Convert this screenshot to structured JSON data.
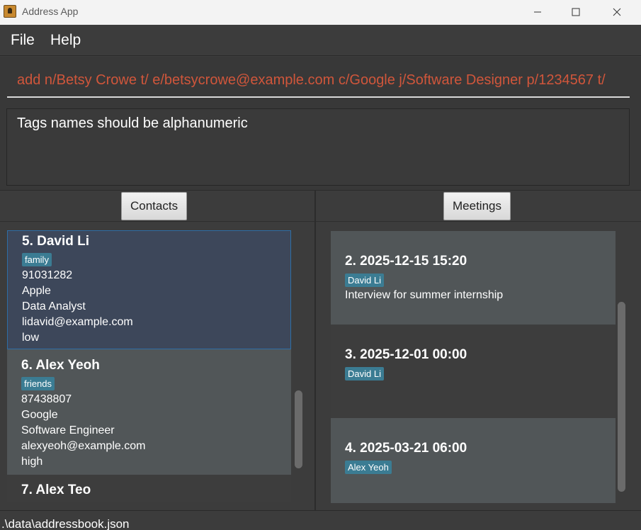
{
  "window": {
    "title": "Address App",
    "icon": "address-book-icon"
  },
  "menu": {
    "items": [
      "File",
      "Help"
    ]
  },
  "command": {
    "value": "add n/Betsy Crowe t/ e/betsycrowe@example.com c/Google j/Software Designer p/1234567 t/"
  },
  "result": {
    "message": "Tags names should be alphanumeric"
  },
  "contacts": {
    "header": "Contacts",
    "items": [
      {
        "name": "5. David Li",
        "tag": "family",
        "phone": "91031282",
        "company": "Apple",
        "job": "Data Analyst",
        "email": "lidavid@example.com",
        "priority": "low"
      },
      {
        "name": "6. Alex Yeoh",
        "tag": "friends",
        "phone": "87438807",
        "company": "Google",
        "job": "Software Engineer",
        "email": "alexyeoh@example.com",
        "priority": "high"
      },
      {
        "name": "7. Alex Teo",
        "tag": "",
        "phone": "",
        "company": "",
        "job": "",
        "email": "",
        "priority": ""
      }
    ]
  },
  "meetings": {
    "header": "Meetings",
    "items": [
      {
        "title": "2. 2025-12-15 15:20",
        "contact": "David Li",
        "description": "Interview for summer internship"
      },
      {
        "title": "3. 2025-12-01 00:00",
        "contact": "David Li",
        "description": ""
      },
      {
        "title": "4. 2025-03-21 06:00",
        "contact": "Alex Yeoh",
        "description": ""
      }
    ]
  },
  "status": {
    "path": ".\\data\\addressbook.json"
  },
  "colors": {
    "background": "#3c3c3c",
    "command_text": "#d0563b",
    "tag": "#3b7c93",
    "selected_card": "#3d475a",
    "selected_border": "#2e6ea5"
  }
}
